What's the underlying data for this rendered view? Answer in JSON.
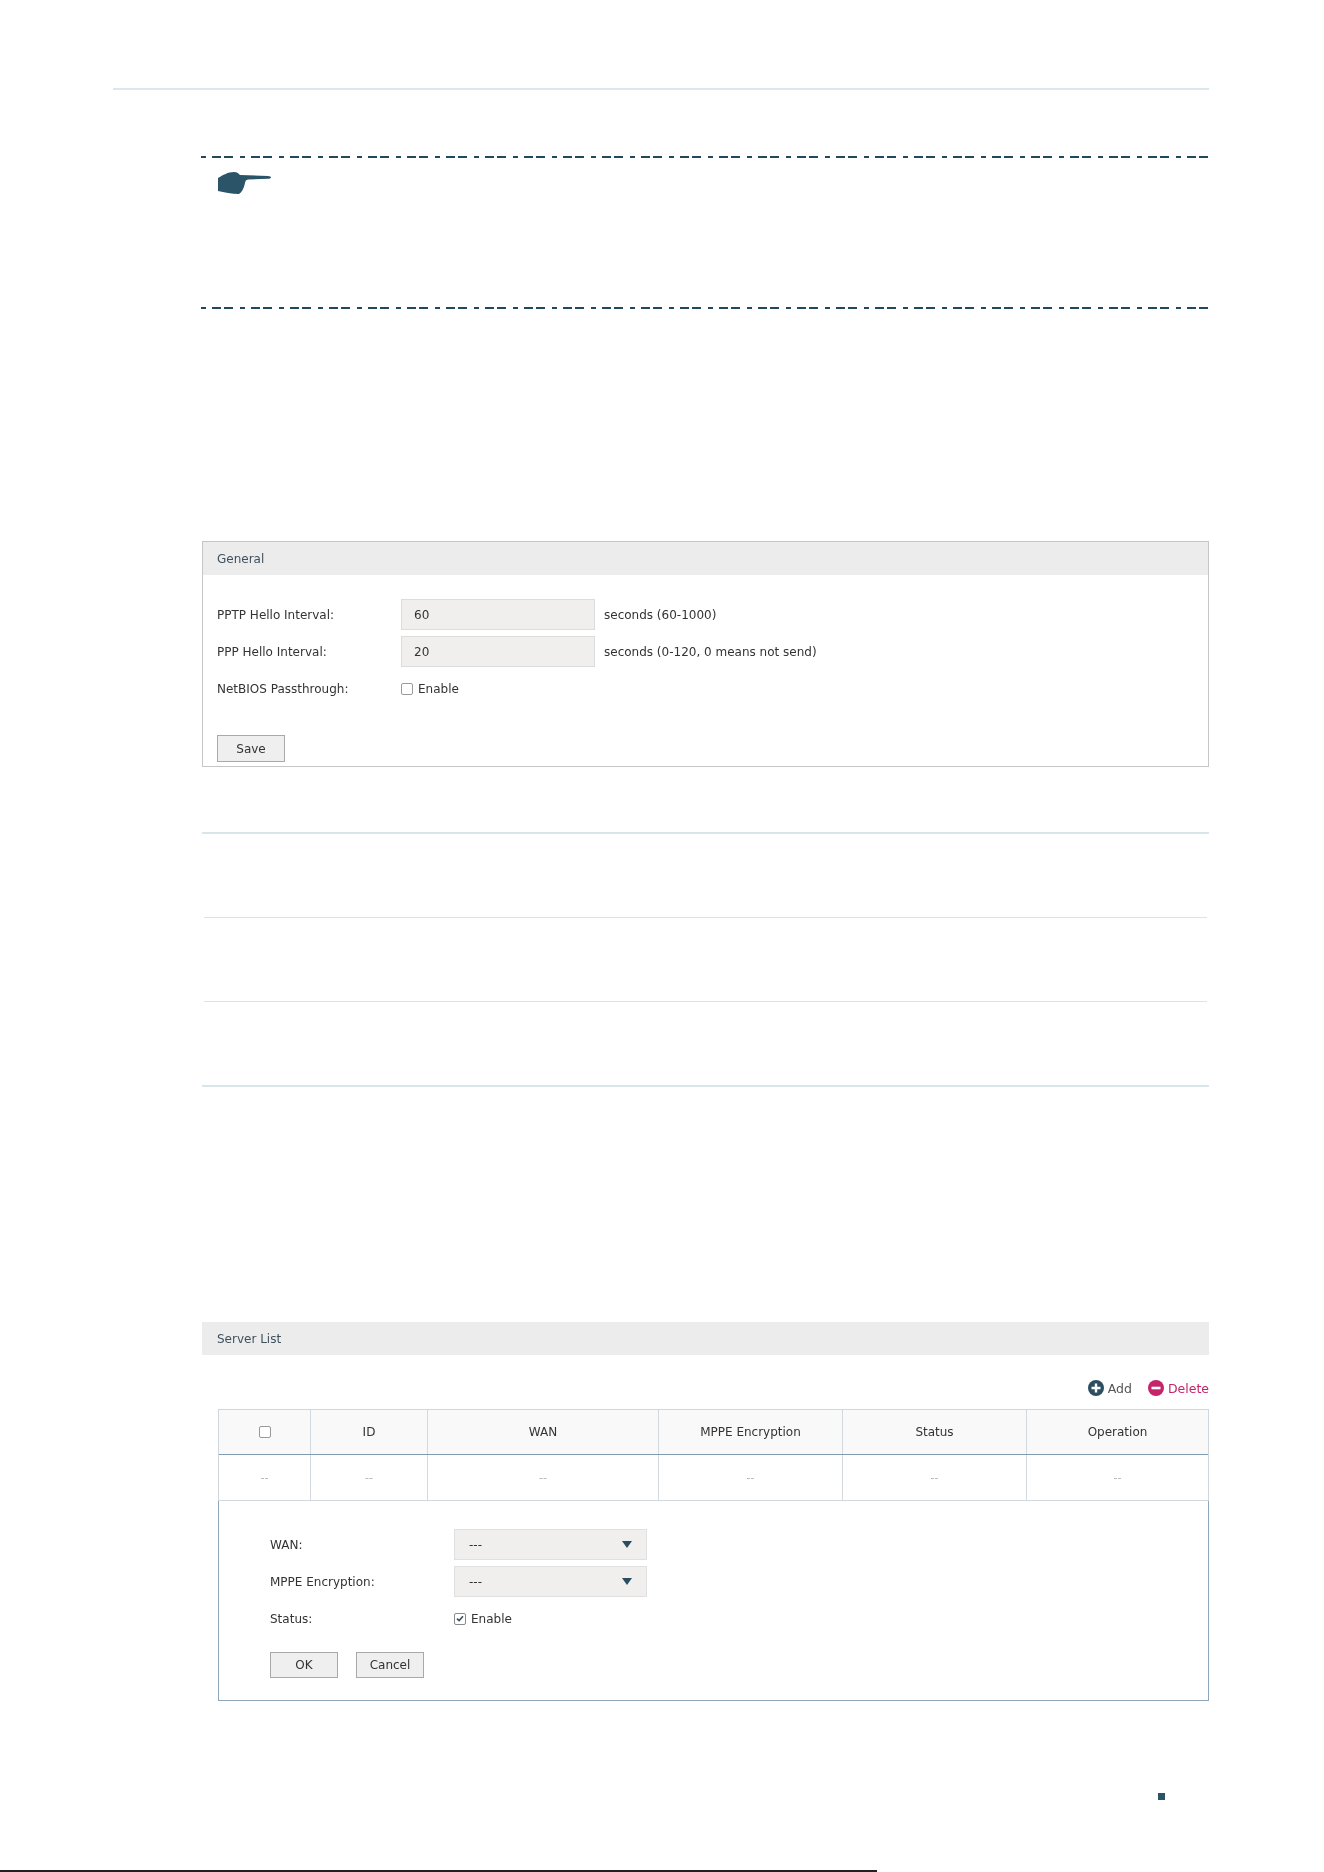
{
  "general_panel": {
    "title": "General",
    "fields": [
      {
        "kind": "text",
        "label": "PPTP Hello Interval:",
        "value": "60",
        "hint": "seconds (60-1000)"
      },
      {
        "kind": "text",
        "label": "PPP Hello Interval:",
        "value": "20",
        "hint": "seconds (0-120, 0 means not send)"
      },
      {
        "kind": "checkbox",
        "label": "NetBIOS Passthrough:",
        "option": "Enable",
        "checked": false
      }
    ],
    "buttons": [
      "Save"
    ]
  },
  "server_list": {
    "title": "Server List",
    "actions": [
      {
        "kind": "add",
        "label": "Add"
      },
      {
        "kind": "delete",
        "label": "Delete"
      }
    ],
    "table": {
      "columns": [
        {
          "kind": "checkbox",
          "checked": false
        },
        {
          "kind": "text",
          "label": "ID"
        },
        {
          "kind": "text",
          "label": "WAN"
        },
        {
          "kind": "text",
          "label": "MPPE Encryption"
        },
        {
          "kind": "text",
          "label": "Status"
        },
        {
          "kind": "text",
          "label": "Operation"
        }
      ],
      "rows": [
        [
          "--",
          "--",
          "--",
          "--",
          "--",
          "--"
        ]
      ]
    },
    "form": {
      "fields": [
        {
          "kind": "select",
          "label": "WAN:",
          "value": "---"
        },
        {
          "kind": "select",
          "label": "MPPE Encryption:",
          "value": "---"
        },
        {
          "kind": "checkbox",
          "label": "Status:",
          "option": "Enable",
          "checked": true
        }
      ],
      "buttons": [
        "OK",
        "Cancel"
      ]
    }
  }
}
